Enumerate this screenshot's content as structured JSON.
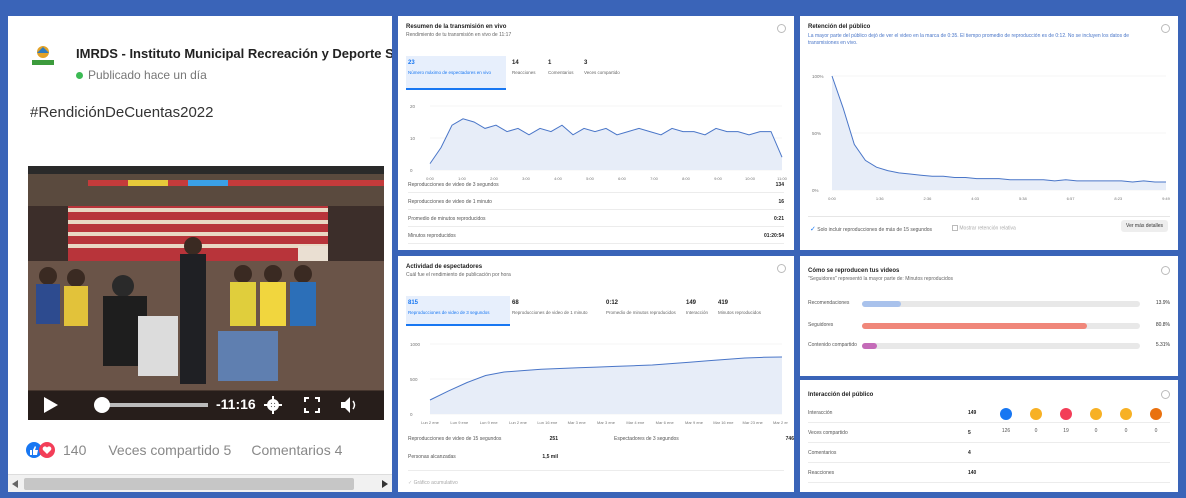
{
  "post": {
    "page_name": "IMRDS - Instituto Municipal Recreación y Deporte So",
    "published": "Publicado hace un día",
    "hashtag": "#RendiciónDeCuentas2022",
    "video_time": "-11:16",
    "reaction_count": "140",
    "shares": "Veces compartido 5",
    "comments": "Comentarios 4"
  },
  "live": {
    "title": "Resumen de la transmisión en vivo",
    "subtitle": "Rendimiento de tu transmisión en vivo de 11:17",
    "metrics": [
      {
        "value": "23",
        "label": "Número máximo de espectadores en vivo"
      },
      {
        "value": "14",
        "label": "Reacciones"
      },
      {
        "value": "1",
        "label": "Comentarios"
      },
      {
        "value": "3",
        "label": "Veces compartido"
      }
    ],
    "y_ticks": [
      "20",
      "10",
      "0"
    ],
    "x_ticks": [
      "0:00",
      "1:00",
      "2:00",
      "3:00",
      "4:00",
      "5:00",
      "6:00",
      "7:00",
      "8:00",
      "9:00",
      "10:00",
      "11:00"
    ],
    "series": [
      2,
      7,
      14,
      16,
      15,
      13,
      14,
      12,
      13,
      11,
      13,
      12,
      14,
      11,
      13,
      12,
      13,
      11,
      12,
      13,
      12,
      11,
      13,
      12,
      12,
      11,
      13,
      12,
      12,
      11,
      12,
      12,
      4
    ],
    "stats": [
      {
        "label": "Reproducciones de video de 3 segundos",
        "value": "134"
      },
      {
        "label": "Reproducciones de video de 1 minuto",
        "value": "16"
      },
      {
        "label": "Promedio de minutos reproducidos",
        "value": "0:21"
      },
      {
        "label": "Minutos reproducidos",
        "value": "01:20:54"
      }
    ]
  },
  "retention": {
    "title": "Retención del público",
    "desc": "La mayor parte del público dejó de ver el video en la marca de 0:35. El tiempo promedio de reproducción es de 0:12. No se incluyen los datos de transmisiones en vivo.",
    "y_ticks": [
      "100%",
      "50%",
      "0%"
    ],
    "x_ticks": [
      "0:00",
      "1:36",
      "2:36",
      "4:03",
      "5:38",
      "6:57",
      "8:23",
      "9:49"
    ],
    "series": [
      100,
      72,
      40,
      26,
      20,
      17,
      15,
      14,
      13,
      12,
      12,
      11,
      11,
      10,
      10,
      10,
      9,
      9,
      9,
      9,
      8,
      9,
      8,
      8,
      8,
      8,
      8,
      7,
      8,
      7,
      7
    ],
    "checkbox1": "Solo incluir reproducciones de más de 15 segundos",
    "checkbox2": "Mostrar retención relativa",
    "details_button": "Ver más detalles"
  },
  "activity": {
    "title": "Actividad de espectadores",
    "subtitle": "Cuál fue el rendimiento de publicación por hora",
    "metrics": [
      {
        "value": "815",
        "label": "Reproducciones de video de 3 segundos"
      },
      {
        "value": "68",
        "label": "Reproducciones de video de 1 minuto"
      },
      {
        "value": "0:12",
        "label": "Promedio de minutos reproducidos"
      },
      {
        "value": "149",
        "label": "Interacción"
      },
      {
        "value": "419",
        "label": "Minutos reproducidos"
      }
    ],
    "y_ticks": [
      "1000",
      "500",
      "0"
    ],
    "x_ticks": [
      "Lun 2 ene",
      "Lun 9 ene",
      "Lun 9 ene",
      "Lun 2 ene",
      "Lun 16 ene",
      "Mar 3 ene",
      "Mar 3 ene",
      "Mar 4 ene",
      "Mar 6 ene",
      "Mar 9 ene",
      "Mar 16 ene",
      "Mar 23 ene",
      "Mar 2 ene"
    ],
    "series": [
      200,
      330,
      450,
      550,
      600,
      620,
      640,
      650,
      660,
      670,
      680,
      690,
      700,
      720,
      740,
      760,
      780,
      800,
      810,
      815
    ],
    "stats": [
      {
        "label": "Reproducciones de video de 15 segundos",
        "value": "251"
      },
      {
        "label": "Personas alcanzadas",
        "value": "1,5 mil"
      },
      {
        "label": "Espectadores de 3 segundos",
        "value": "746"
      }
    ],
    "footer": "Gráfico acumulativo"
  },
  "howplayed": {
    "title": "Cómo se reproducen tus videos",
    "subtitle": "\"Seguidores\" representó la mayor parte de: Minutos reproducidos",
    "rows": [
      {
        "label": "Recomendaciones",
        "value": "13.9%",
        "fraction": 0.139,
        "color": "#a9c2ec"
      },
      {
        "label": "Seguidores",
        "value": "80.8%",
        "fraction": 0.808,
        "color": "#f0877a"
      },
      {
        "label": "Contenido compartido",
        "value": "5.31%",
        "fraction": 0.053,
        "color": "#c46bb8"
      }
    ]
  },
  "interaction": {
    "title": "Interacción del público",
    "rows": [
      {
        "label": "Interacción",
        "value": "149"
      },
      {
        "label": "Veces compartido",
        "value": "5"
      },
      {
        "label": "Comentarios",
        "value": "4"
      },
      {
        "label": "Reacciones",
        "value": "140"
      }
    ],
    "reactions": [
      {
        "name": "like",
        "count": "126",
        "color": "#1877f2"
      },
      {
        "name": "wow",
        "count": "0",
        "color": "#f7b125"
      },
      {
        "name": "love",
        "count": "19",
        "color": "#f33e58"
      },
      {
        "name": "haha",
        "count": "0",
        "color": "#f7b125"
      },
      {
        "name": "care",
        "count": "0",
        "color": "#f7b125"
      },
      {
        "name": "angry",
        "count": "0",
        "color": "#e9710f"
      }
    ]
  },
  "colors": {
    "accent": "#1877f2",
    "chart_fill": "#e7edf8",
    "chart_line": "#4a76c8",
    "frame": "#3a64b8"
  }
}
